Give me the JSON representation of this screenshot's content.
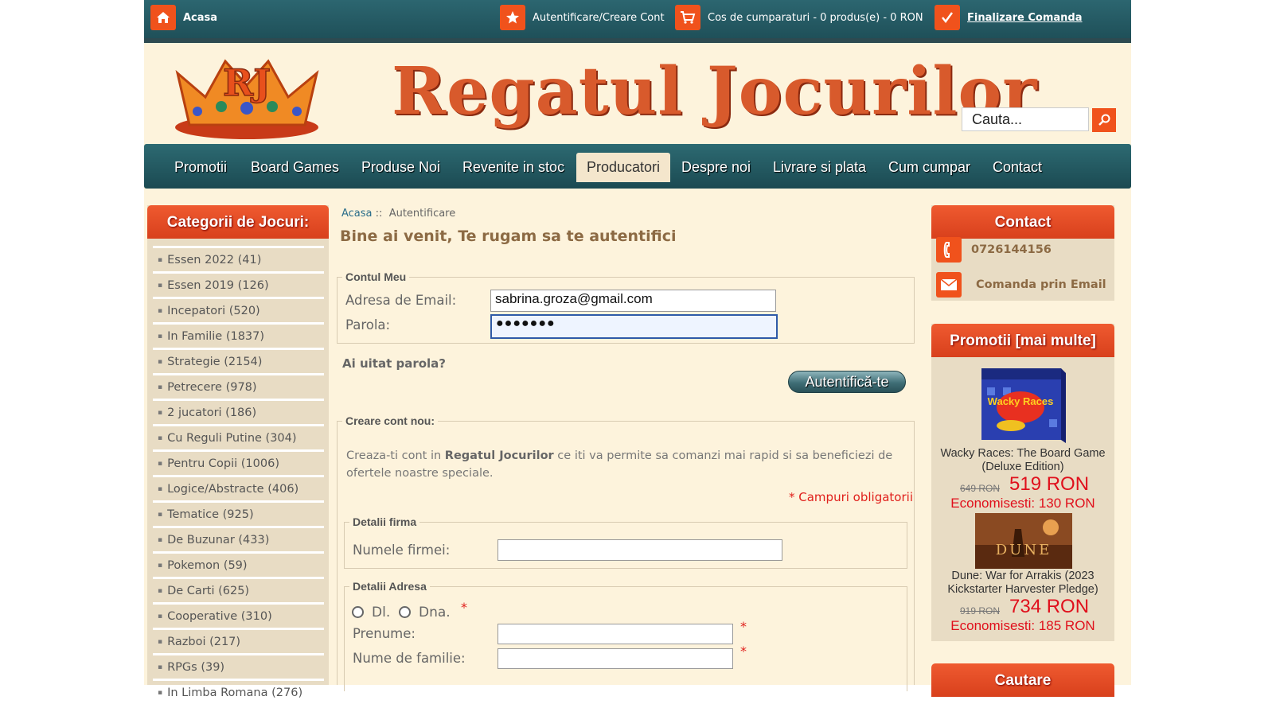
{
  "topbar": {
    "home_label": "Acasa",
    "login_label": "Autentificare/Creare Cont",
    "cart_label": "Cos de cumparaturi - 0 produs(e) - 0 RON",
    "checkout_label": "Finalizare Comanda"
  },
  "header": {
    "brand": "Regatul Jocurilor",
    "logo_text": "RJ",
    "search_placeholder": "Cauta..."
  },
  "nav": [
    "Promotii",
    "Board Games",
    "Produse Noi",
    "Revenite in stoc",
    "Producatori",
    "Despre noi",
    "Livrare si plata",
    "Cum cumpar",
    "Contact"
  ],
  "nav_active": "Producatori",
  "categories": {
    "title": "Categorii de Jocuri:",
    "items": [
      "Essen 2022 (41)",
      "Essen 2019 (126)",
      "Incepatori (520)",
      "In Familie (1837)",
      "Strategie (2154)",
      "Petrecere (978)",
      "2 jucatori (186)",
      "Cu Reguli Putine (304)",
      "Pentru Copii (1006)",
      "Logice/Abstracte (406)",
      "Tematice (925)",
      "De Buzunar (433)",
      "Pokemon (59)",
      "De Carti (625)",
      "Cooperative (310)",
      "Razboi (217)",
      "RPGs (39)",
      "In Limba Romana (276)"
    ]
  },
  "breadcrumb": {
    "home": "Acasa",
    "sep": "::",
    "current": "Autentificare"
  },
  "page_title": "Bine ai venit, Te rugam sa te autentifici",
  "login": {
    "legend": "Contul Meu",
    "email_label": "Adresa de Email:",
    "email_value": "sabrina.groza@gmail.com",
    "password_label": "Parola:",
    "password_value": "●●●●●●●",
    "forgot": "Ai uitat parola?",
    "submit": "Autentifică-te"
  },
  "register": {
    "legend": "Creare cont nou:",
    "intro_pre": "Creaza-ti cont in ",
    "intro_brand": "Regatul Jocurilor",
    "intro_post": " ce iti va permite sa comanzi mai rapid si sa beneficiezi de ofertele noastre speciale.",
    "required_note": "* Campuri obligatorii",
    "company_legend": "Detalii firma",
    "company_label": "Numele firmei:",
    "address_legend": "Detalii Adresa",
    "mr": "Dl.",
    "mrs": "Dna.",
    "firstname_label": "Prenume:",
    "lastname_label": "Nume de familie:",
    "asterisk": "*"
  },
  "contact": {
    "title": "Contact",
    "phone": "0726144156",
    "email_order": "Comanda prin Email"
  },
  "promotions": {
    "title": "Promotii  [mai multe]",
    "products": [
      {
        "name": "Wacky Races: The Board Game (Deluxe Edition)",
        "old_price": "649 RON",
        "new_price": "519 RON",
        "savings": "Economisesti: 130 RON",
        "box_title": "Wacky Races"
      },
      {
        "name": "Dune: War for Arrakis (2023 Kickstarter Harvester Pledge)",
        "old_price": "919 RON",
        "new_price": "734 RON",
        "savings": "Economisesti: 185 RON",
        "box_title": "DUNE"
      }
    ]
  },
  "search_panel": {
    "title": "Cautare"
  },
  "colors": {
    "accent": "#f0521c",
    "teal": "#1f5059",
    "cream": "#fdf3dc",
    "panel": "#e8dcc4"
  }
}
